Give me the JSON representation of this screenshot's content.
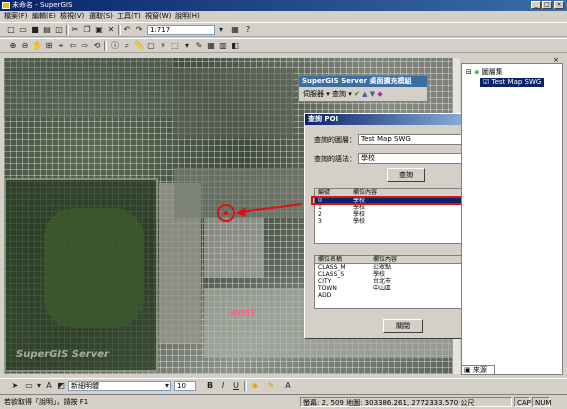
{
  "window": {
    "title": "未命名 - SuperGIS",
    "min": "_",
    "max": "□",
    "close": "×"
  },
  "menus": [
    "檔案(F)",
    "編輯(E)",
    "檢視(V)",
    "選取(S)",
    "工具(T)",
    "視窗(W)",
    "說明(H)"
  ],
  "toolbar": {
    "scale": "1:717"
  },
  "map": {
    "watermark": "SuperGIS Server",
    "label": "AS551"
  },
  "float_toolbar": {
    "title": "SuperGIS Server 桌面擴充模組",
    "server_menu": "伺服器",
    "query_menu": "查詢"
  },
  "dialog": {
    "title": "查詢 POI",
    "layer_label": "查詢的圖層：",
    "layer_value": "Test Map SWG",
    "query_label": "查詢的語法：",
    "query_value": "學校",
    "query_button": "查詢",
    "results_headers": [
      "編號",
      "欄位內容"
    ],
    "results": [
      {
        "id": "0",
        "value": "學校"
      },
      {
        "id": "1",
        "value": "學校"
      },
      {
        "id": "2",
        "value": "學校"
      },
      {
        "id": "3",
        "value": "學校"
      }
    ],
    "attr_headers": [
      "欄位名稱",
      "欄位內容"
    ],
    "attributes": [
      {
        "name": "CLASS_M",
        "value": "公眾點"
      },
      {
        "name": "CLASS_S",
        "value": "學校"
      },
      {
        "name": "CITY",
        "value": "台北市"
      },
      {
        "name": "TOWN",
        "value": "中山區"
      },
      {
        "name": "ADD",
        "value": ""
      }
    ],
    "close_button": "關閉"
  },
  "layers_panel": {
    "root": "圖層集",
    "layer": "Test Map SWG",
    "tab": "來源"
  },
  "drawing": {
    "font": "新細明體",
    "size": "10",
    "bold": "B",
    "italic": "I",
    "underline": "U"
  },
  "status": {
    "help": "若欲取得「說明」，請按 F1",
    "coords": "螢幕: 2, 509  地圖: 303386.261, 2772333.570 公尺",
    "caps": "CAP",
    "num": "NUM"
  },
  "colors": {
    "accent": "#0a246a",
    "highlight": "#e01010"
  }
}
